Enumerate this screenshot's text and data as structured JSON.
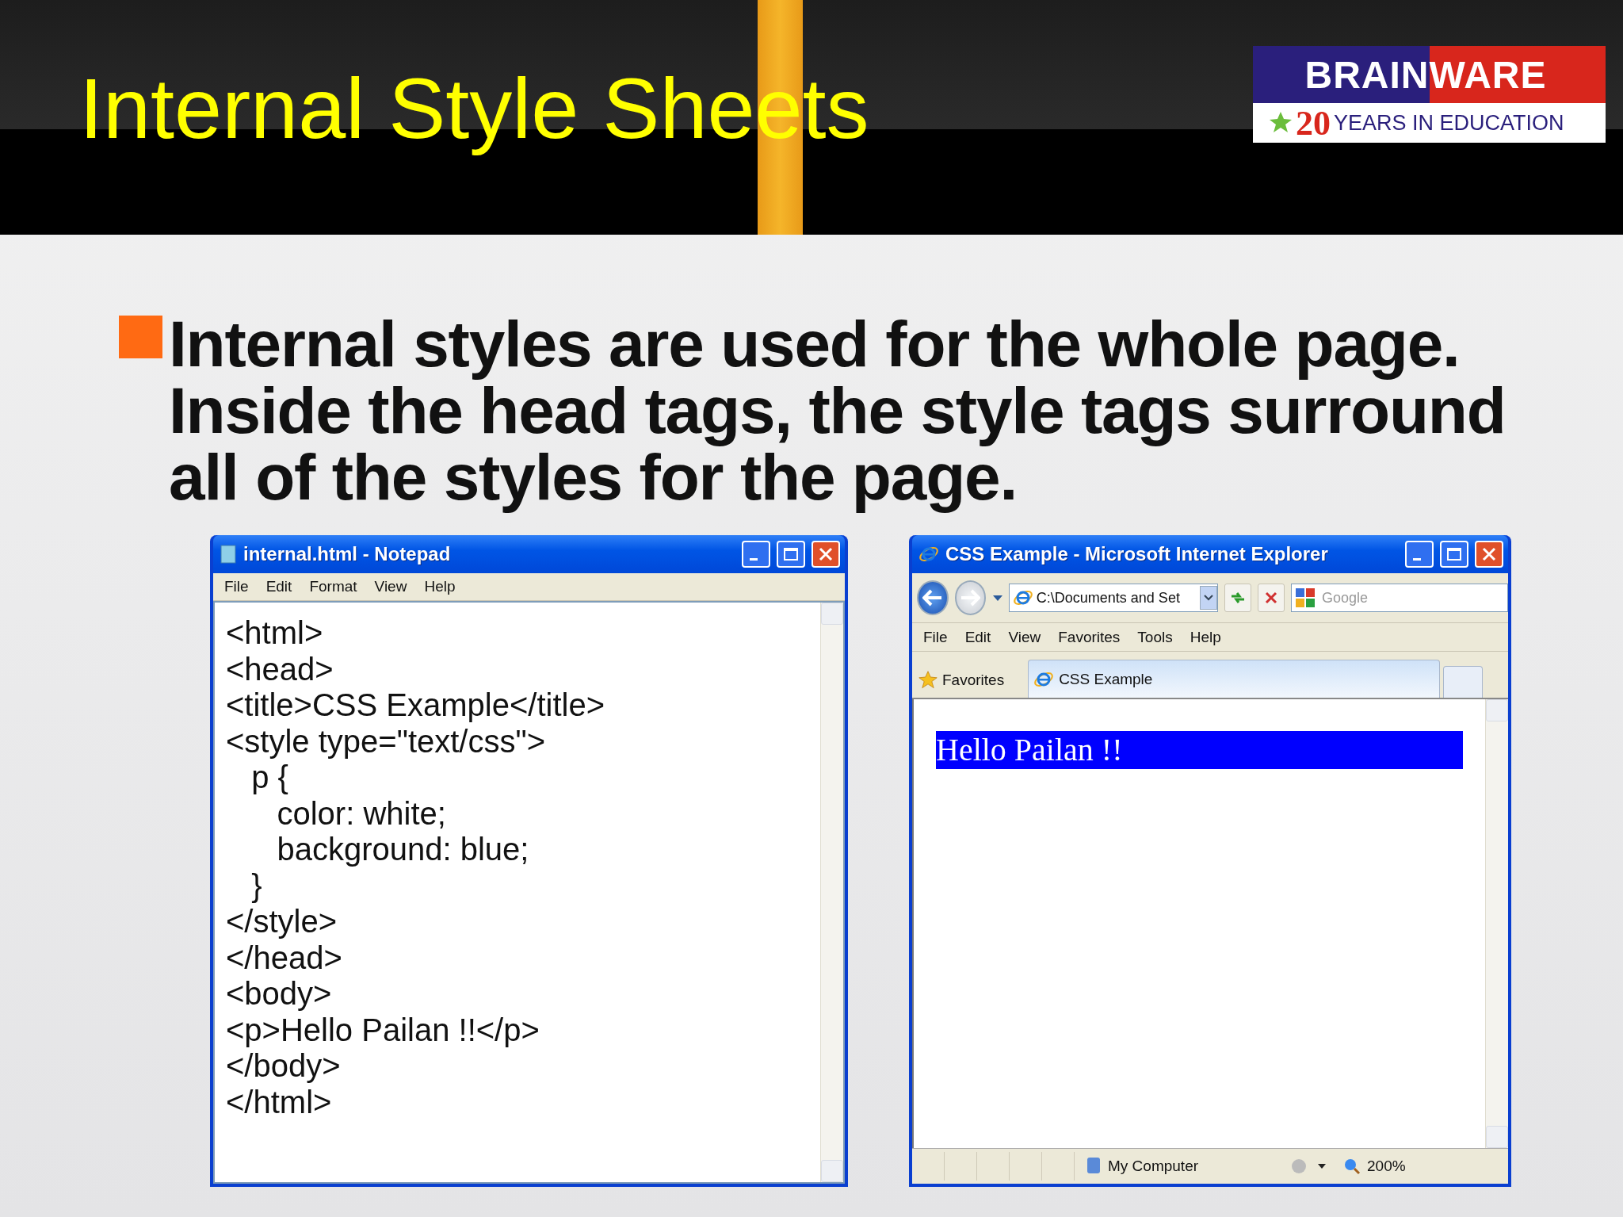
{
  "slide": {
    "title": "Internal Style Sheets",
    "logo": {
      "brand_left": "BRAIN",
      "brand_right": "WARE",
      "number": "20",
      "tagline": "YEARS IN EDUCATION"
    },
    "bullet": "Internal styles are used for the whole page. Inside the head tags, the style tags surround all of the styles for the page."
  },
  "notepad": {
    "title": "internal.html - Notepad",
    "menu": [
      "File",
      "Edit",
      "Format",
      "View",
      "Help"
    ],
    "code": [
      "<html>",
      "<head>",
      "<title>CSS Example</title>",
      "<style type=\"text/css\">",
      "\tp {",
      "\t\tcolor: white;",
      "\t\tbackground: blue;",
      "\t}",
      "</style>",
      "</head>",
      "<body>",
      "<p>Hello Pailan !!</p>",
      "</body>",
      "</html>"
    ]
  },
  "browser": {
    "title": "CSS Example - Microsoft Internet Explorer",
    "address": "C:\\Documents and Set",
    "search_placeholder": "Google",
    "menu": [
      "File",
      "Edit",
      "View",
      "Favorites",
      "Tools",
      "Help"
    ],
    "favorites": "Favorites",
    "tab": "CSS Example",
    "content": "Hello Pailan !!",
    "status": "My Computer",
    "zoom": "200%"
  }
}
